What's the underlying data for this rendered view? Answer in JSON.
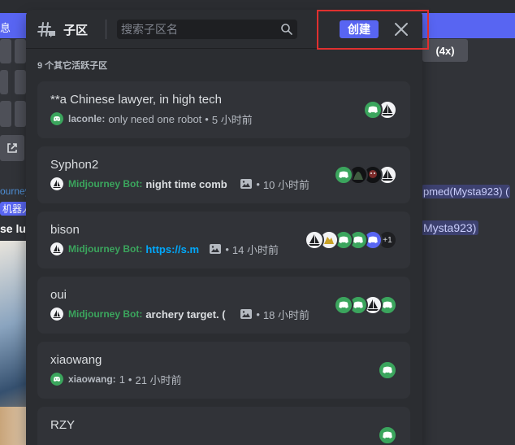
{
  "background": {
    "banner_left_text": "息",
    "upscale_label": "(4x)",
    "mention1": "pmed(Mysta923) (",
    "mention2": "Mysta923)",
    "left_text1": "ourney",
    "left_text2": "机器人",
    "left_text3": "se lu"
  },
  "header": {
    "title": "子区",
    "search_placeholder": "搜索子区名",
    "create_label": "创建"
  },
  "section_label": "9 个其它活跃子区",
  "threads": [
    {
      "name": "**a Chinese lawyer, in high tech",
      "author": "laconle:",
      "message": "only need one robot",
      "time": "5 小时前"
    },
    {
      "name": "Syphon2",
      "author": "Midjourney Bot:",
      "message": "night time comb",
      "time": "10 小时前"
    },
    {
      "name": "bison",
      "author": "Midjourney Bot:",
      "message": "https://s.m",
      "time": "14 小时前",
      "more_count": "+1"
    },
    {
      "name": "oui",
      "author": "Midjourney Bot:",
      "message": "archery target. (",
      "time": "18 小时前"
    },
    {
      "name": "xiaowang",
      "author": "xiaowang:",
      "message": "1",
      "time": "21 小时前"
    },
    {
      "name": "RZY"
    }
  ],
  "colors": {
    "accent": "#5865f2",
    "bot_green": "#3ba55d",
    "link_blue": "#00a8fc",
    "highlight_red": "#e0302f"
  }
}
